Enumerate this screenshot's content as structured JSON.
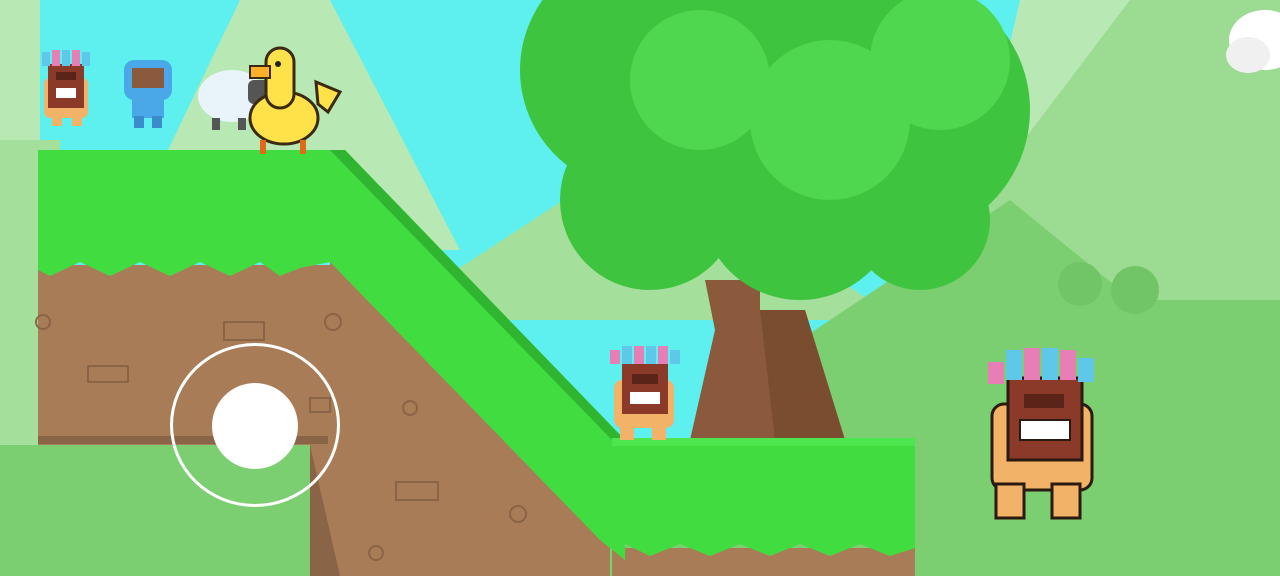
{
  "game": {
    "colors": {
      "sky": "#5ef0ee",
      "far_hill": "#b8e8b4",
      "mid_hill": "#9edc94",
      "near_hill": "#7ccf70",
      "grass": "#40dc40",
      "grass_dark": "#2fb52f",
      "dirt": "#a97c58",
      "dirt_dark": "#8a6446",
      "trunk": "#8b5a3c",
      "trunk_dark": "#6e452c",
      "leaves": "#3fc43f",
      "leaves_light": "#4fd74f",
      "cloud": "#ffffff"
    },
    "character_select": [
      {
        "name": "tiki-mask-lion",
        "icon": "tiki-mask-icon"
      },
      {
        "name": "blue-astronaut",
        "icon": "astronaut-icon"
      },
      {
        "name": "sheep",
        "icon": "sheep-icon"
      },
      {
        "name": "yellow-chicken",
        "icon": "chicken-icon",
        "selected": true
      }
    ],
    "controls": {
      "joystick": "virtual-joystick"
    }
  }
}
